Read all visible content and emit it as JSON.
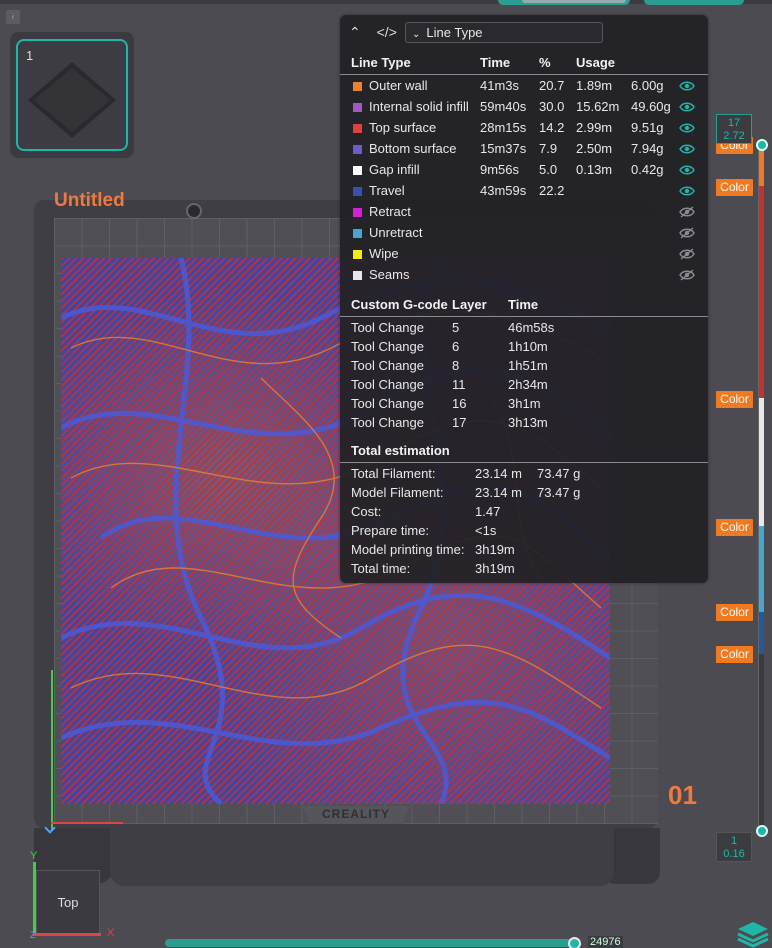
{
  "plate": {
    "thumbnail_number": "1",
    "title": "Untitled",
    "plate_number": "01",
    "brand": "CREALITY"
  },
  "view_cube": {
    "label": "Top",
    "axis_y": "Y",
    "axis_x": "X",
    "axis_z": "Z"
  },
  "legend": {
    "dropdown": "Line Type",
    "headers": {
      "line_type": "Line Type",
      "time": "Time",
      "percent": "%",
      "usage": "Usage"
    },
    "rows": [
      {
        "name": "Outer wall",
        "color": "#ef7f35",
        "time": "41m3s",
        "percent": "20.7",
        "len": "1.89m",
        "weight": "6.00g",
        "visible": true
      },
      {
        "name": "Internal solid infill",
        "color": "#a455c8",
        "time": "59m40s",
        "percent": "30.0",
        "len": "15.62m",
        "weight": "49.60g",
        "visible": true
      },
      {
        "name": "Top surface",
        "color": "#e0413f",
        "time": "28m15s",
        "percent": "14.2",
        "len": "2.99m",
        "weight": "9.51g",
        "visible": true
      },
      {
        "name": "Bottom surface",
        "color": "#6a5bd0",
        "time": "15m37s",
        "percent": "7.9",
        "len": "2.50m",
        "weight": "7.94g",
        "visible": true
      },
      {
        "name": "Gap infill",
        "color": "#ffffff",
        "time": "9m56s",
        "percent": "5.0",
        "len": "0.13m",
        "weight": "0.42g",
        "visible": true
      },
      {
        "name": "Travel",
        "color": "#3a4fb0",
        "time": "43m59s",
        "percent": "22.2",
        "len": "",
        "weight": "",
        "visible": true
      },
      {
        "name": "Retract",
        "color": "#d21fd8",
        "time": "",
        "percent": "",
        "len": "",
        "weight": "",
        "visible": false
      },
      {
        "name": "Unretract",
        "color": "#44a7cf",
        "time": "",
        "percent": "",
        "len": "",
        "weight": "",
        "visible": false
      },
      {
        "name": "Wipe",
        "color": "#f5ea16",
        "time": "",
        "percent": "",
        "len": "",
        "weight": "",
        "visible": false
      },
      {
        "name": "Seams",
        "color": "#e6e6e6",
        "time": "",
        "percent": "",
        "len": "",
        "weight": "",
        "visible": false
      }
    ],
    "gcode_headers": {
      "name": "Custom G-code",
      "layer": "Layer",
      "time": "Time"
    },
    "gcode_rows": [
      {
        "name": "Tool Change",
        "layer": "5",
        "time": "46m58s"
      },
      {
        "name": "Tool Change",
        "layer": "6",
        "time": "1h10m"
      },
      {
        "name": "Tool Change",
        "layer": "8",
        "time": "1h51m"
      },
      {
        "name": "Tool Change",
        "layer": "11",
        "time": "2h34m"
      },
      {
        "name": "Tool Change",
        "layer": "16",
        "time": "3h1m"
      },
      {
        "name": "Tool Change",
        "layer": "17",
        "time": "3h13m"
      }
    ],
    "total_title": "Total estimation",
    "totals": [
      {
        "label": "Total Filament:",
        "value": "23.14 m",
        "extra": "73.47 g"
      },
      {
        "label": "Model Filament:",
        "value": "23.14 m",
        "extra": "73.47 g"
      },
      {
        "label": "Cost:",
        "value": "1.47",
        "extra": ""
      },
      {
        "label": "Prepare time:",
        "value": "<1s",
        "extra": ""
      },
      {
        "label": "Model printing time:",
        "value": "3h19m",
        "extra": ""
      },
      {
        "label": "Total time:",
        "value": "3h19m",
        "extra": ""
      }
    ]
  },
  "layer_slider": {
    "top_layer": "17",
    "top_height": "2.72",
    "bottom_layer": "1",
    "bottom_height": "0.16",
    "color_button_label": "Color",
    "segment_colors": [
      "#f07a22",
      "#c8302e",
      "#e8e8e8",
      "#44a7cf",
      "#1f5a9e",
      "#3a3a40"
    ]
  },
  "move_slider": {
    "value": "24976"
  }
}
